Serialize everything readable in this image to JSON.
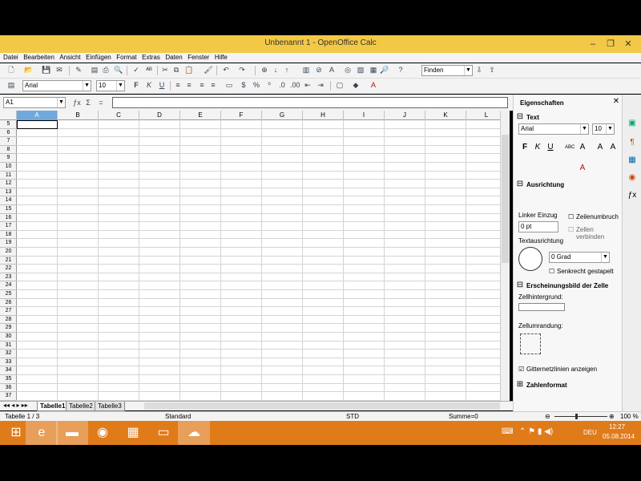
{
  "window": {
    "title": "Unbenannt 1 - OpenOffice Calc"
  },
  "menubar": {
    "items": [
      "Datei",
      "Bearbeiten",
      "Ansicht",
      "Einfügen",
      "Format",
      "Extras",
      "Daten",
      "Fenster",
      "Hilfe"
    ]
  },
  "toolbar": {
    "find_value": "Finden",
    "font_name": "Arial",
    "font_size": "10"
  },
  "formulabar": {
    "cell_ref": "A1",
    "formula_value": ""
  },
  "sheet": {
    "columns": [
      "A",
      "B",
      "C",
      "D",
      "E",
      "F",
      "G",
      "H",
      "I",
      "J",
      "K",
      "L"
    ],
    "rows": [
      "5",
      "6",
      "7",
      "8",
      "9",
      "10",
      "11",
      "12",
      "13",
      "14",
      "15",
      "16",
      "17",
      "18",
      "19",
      "20",
      "21",
      "22",
      "23",
      "24",
      "25",
      "26",
      "27",
      "28",
      "29",
      "30",
      "31",
      "32",
      "33",
      "34",
      "35",
      "36",
      "37"
    ],
    "selected_cell": "A1",
    "tabs": [
      "Tabelle1",
      "Tabelle2",
      "Tabelle3"
    ],
    "active_tab": "Tabelle1"
  },
  "status": {
    "sheet": "Tabelle 1 / 3",
    "pagestyle": "Standard",
    "mode": "STD",
    "sum": "Summe=0",
    "zoom": "100 %"
  },
  "sidebar": {
    "title": "Eigenschaften",
    "text_section": "Text",
    "font_name": "Arial",
    "font_size": "10",
    "align_section": "Ausrichtung",
    "left_indent_label": "Linker Einzug",
    "left_indent_value": "0 pt",
    "wrap_label": "Zeilenumbruch",
    "merge_label": "Zellen verbinden",
    "text_orient_label": "Textausrichtung",
    "angle_value": "0 Grad",
    "stacked_label": "Senkrecht gestapelt",
    "appearance_section": "Erscheinungsbild der Zelle",
    "cell_bg_label": "Zellhintergrund:",
    "border_label": "Zellumrandung:",
    "gridlines_label": "Gitternetzlinien anzeigen",
    "numfmt_section": "Zahlenformat"
  },
  "taskbar": {
    "time": "12:27",
    "date": "05.08.2014",
    "lang": "DEU"
  },
  "colors": {
    "title": "#f3c847",
    "taskbar": "#e07b1a",
    "selection": "#6fa8dc"
  }
}
